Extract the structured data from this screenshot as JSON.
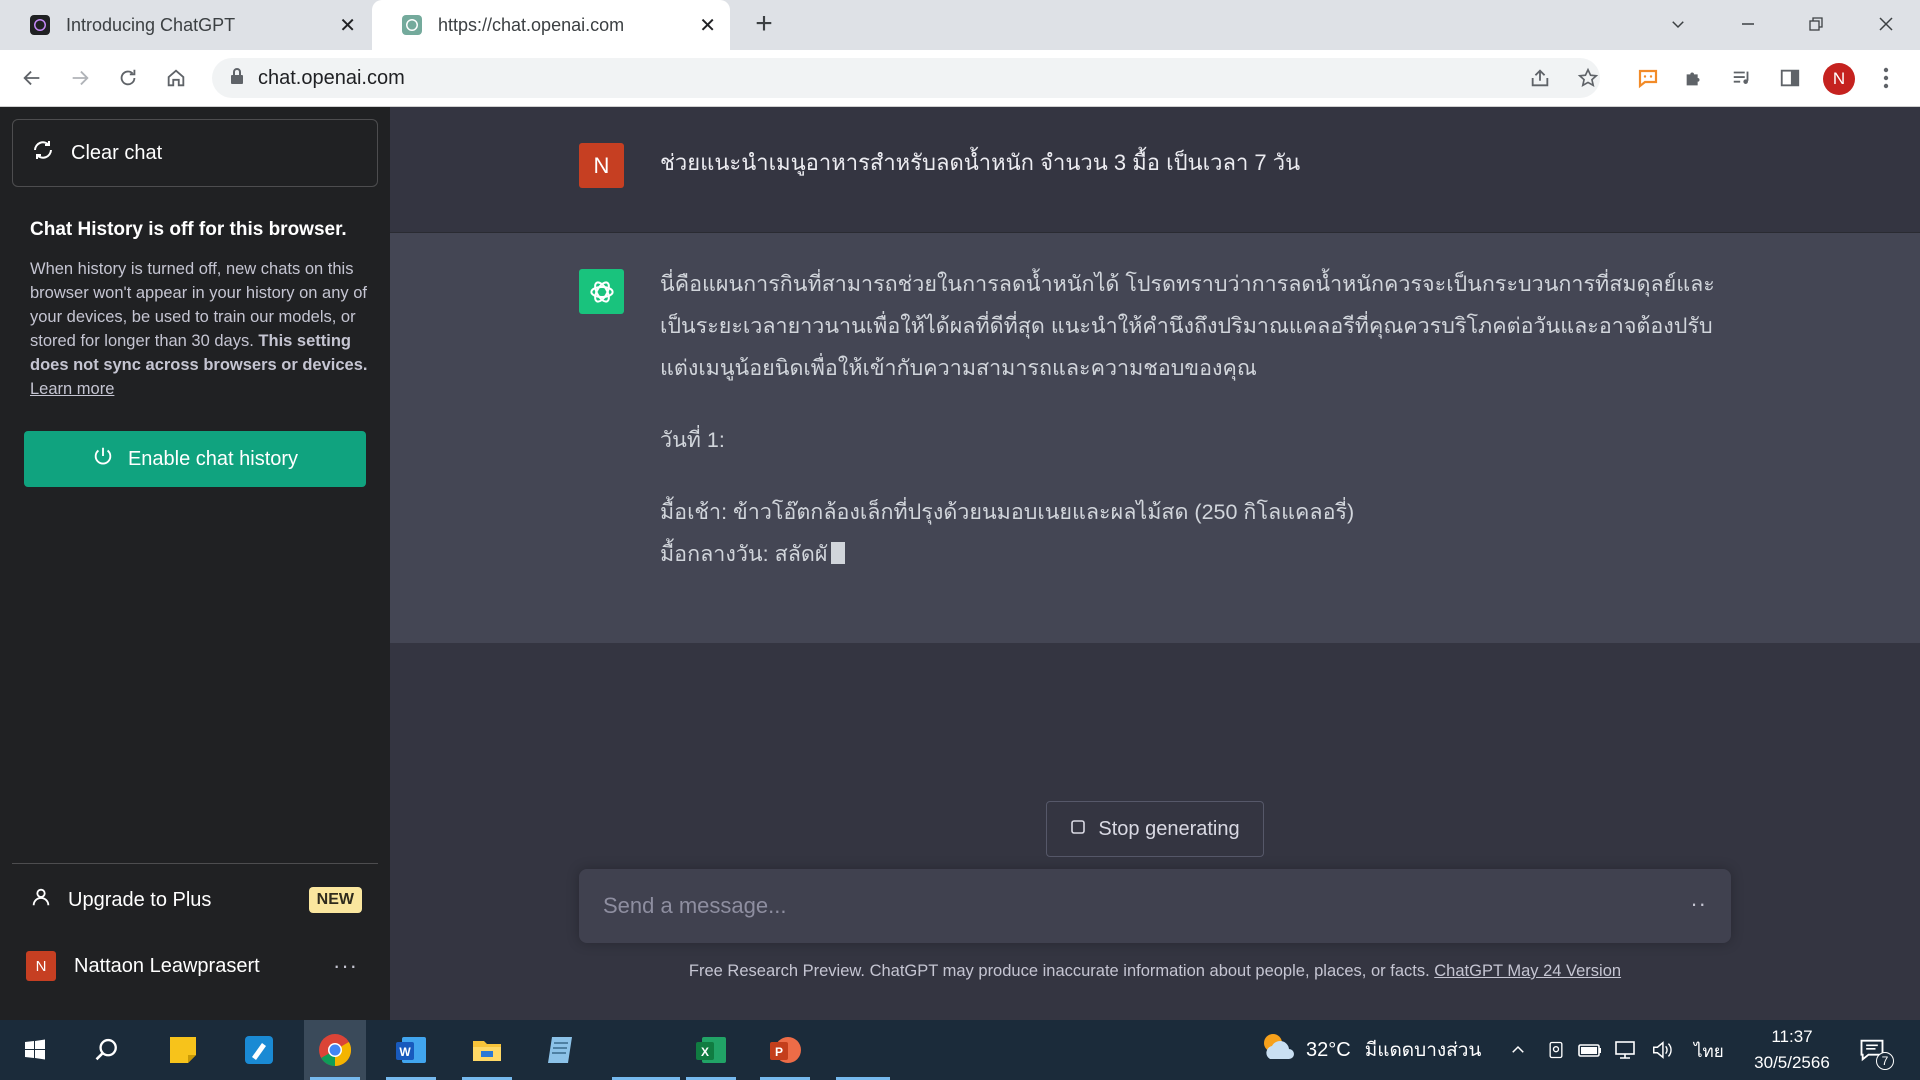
{
  "browser": {
    "tabs": [
      {
        "title": "Introducing ChatGPT",
        "active": false
      },
      {
        "title": "https://chat.openai.com",
        "active": true
      }
    ],
    "url": "chat.openai.com",
    "profile_initial": "N"
  },
  "sidebar": {
    "clear_chat_label": "Clear chat",
    "history_title": "Chat History is off for this browser.",
    "history_desc": "When history is turned off, new chats on this browser won't appear in your history on any of your devices, be used to train our models, or stored for longer than 30 days.",
    "history_desc_bold": "This setting does not sync across browsers or devices.",
    "learn_more": "Learn more",
    "enable_history_label": "Enable chat history",
    "upgrade_label": "Upgrade to Plus",
    "new_badge": "NEW",
    "user_initial": "N",
    "user_name": "Nattaon Leawprasert",
    "user_menu": "···"
  },
  "conversation": {
    "user_initial": "N",
    "user_message": "ช่วยแนะนำเมนูอาหารสำหรับลดน้ำหนัก จำนวน 3 มื้อ เป็นเวลา 7 วัน",
    "assistant_paragraph_1": "นี่คือแผนการกินที่สามารถช่วยในการลดน้ำหนักได้ โปรดทราบว่าการลดน้ำหนักควรจะเป็นกระบวนการที่สมดุลย์และเป็นระยะเวลายาวนานเพื่อให้ได้ผลที่ดีที่สุด แนะนำให้คำนึงถึงปริมาณแคลอรีที่คุณควรบริโภคต่อวันและอาจต้องปรับแต่งเมนูน้อยนิดเพื่อให้เข้ากับความสามารถและความชอบของคุณ",
    "assistant_paragraph_2": "วันที่ 1:",
    "assistant_line_breakfast": "มื้อเช้า: ข้าวโอ๊ตกล้องเล็กที่ปรุงด้วยนมอบเนยและผลไม้สด (250 กิโลแคลอรี่)",
    "assistant_line_lunch": "มื้อกลางวัน: สลัดผั"
  },
  "composer": {
    "stop_label": "Stop generating",
    "placeholder": "Send a message...",
    "menu": "··"
  },
  "disclaimer": {
    "text": "Free Research Preview. ChatGPT may produce inaccurate information about people, places, or facts.",
    "link": "ChatGPT May 24 Version"
  },
  "taskbar": {
    "temperature": "32°C",
    "weather_condition": "มีแดดบางส่วน",
    "language": "ไทย",
    "time": "11:37",
    "date": "30/5/2566",
    "notification_count": "7"
  },
  "colors": {
    "accent": "#10a37f",
    "sidebar_bg": "#202123",
    "main_bg": "#343541",
    "assistant_bg": "#444654",
    "user_avatar": "#c63f22",
    "badge": "#fae69e"
  }
}
